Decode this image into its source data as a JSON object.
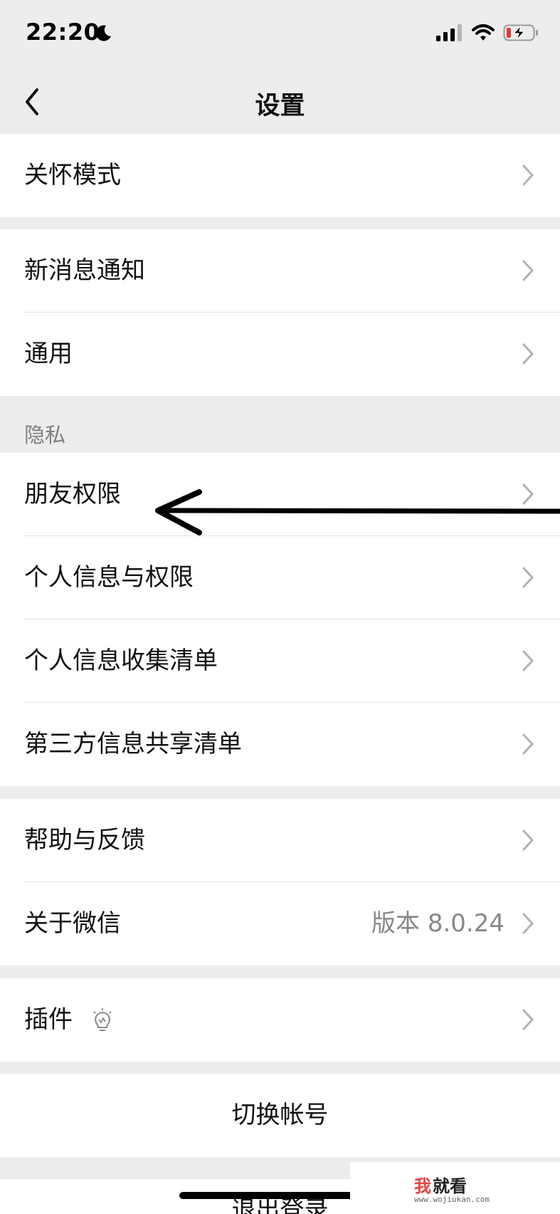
{
  "status_bar": {
    "time": "22:20"
  },
  "nav": {
    "title": "设置"
  },
  "groups": {
    "care": {
      "items": [
        {
          "label": "关怀模式"
        }
      ]
    },
    "general": {
      "items": [
        {
          "label": "新消息通知"
        },
        {
          "label": "通用"
        }
      ]
    },
    "privacy": {
      "section_label": "隐私",
      "items": [
        {
          "label": "朋友权限"
        },
        {
          "label": "个人信息与权限"
        },
        {
          "label": "个人信息收集清单"
        },
        {
          "label": "第三方信息共享清单"
        }
      ]
    },
    "help": {
      "items": [
        {
          "label": "帮助与反馈"
        },
        {
          "label": "关于微信",
          "value": "版本 8.0.24"
        }
      ]
    },
    "plugins": {
      "items": [
        {
          "label": "插件"
        }
      ]
    },
    "account": {
      "switch_label": "切换帐号",
      "logout_label": "退出登录"
    }
  },
  "watermark": {
    "text_red": "我",
    "text_dark": "就看",
    "url": "www.wojiukan.com"
  },
  "colors": {
    "background": "#ededed",
    "card": "#ffffff",
    "chevron": "#b2b2b2",
    "secondary_text": "#888888"
  }
}
